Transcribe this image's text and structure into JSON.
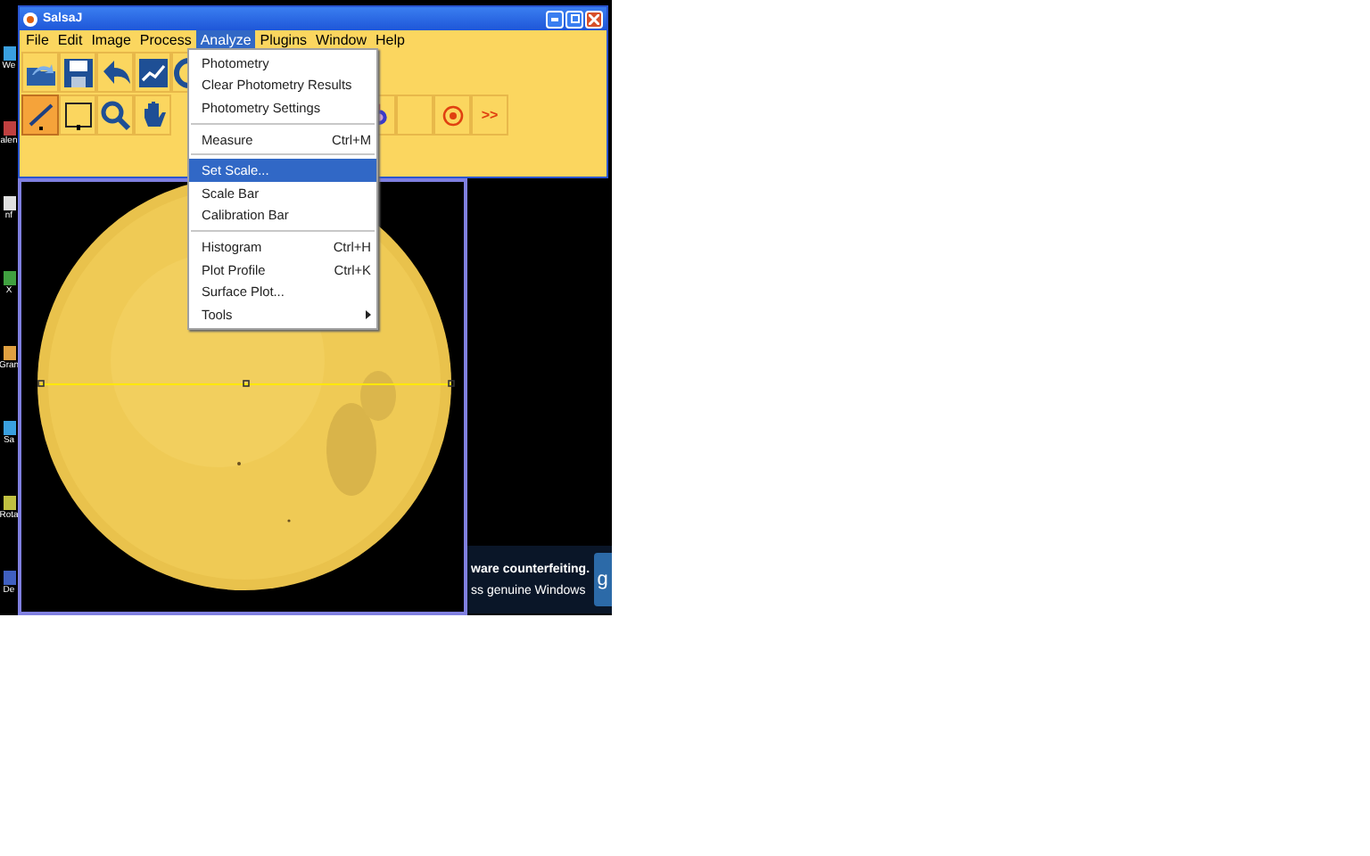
{
  "desktop": {
    "icon_labels": [
      "We",
      "alen",
      "nf",
      "X",
      "Gran",
      "Sa",
      "Rota",
      "De"
    ]
  },
  "app_window": {
    "title": "SalsaJ",
    "menu": [
      {
        "label": "File",
        "selected": false
      },
      {
        "label": "Edit",
        "selected": false
      },
      {
        "label": "Image",
        "selected": false
      },
      {
        "label": "Process",
        "selected": false
      },
      {
        "label": "Analyze",
        "selected": true
      },
      {
        "label": "Plugins",
        "selected": false
      },
      {
        "label": "Window",
        "selected": false
      },
      {
        "label": "Help",
        "selected": false
      }
    ],
    "toolbar_row_1": [
      {
        "kind": "open",
        "selected": false
      },
      {
        "kind": "save",
        "selected": false
      },
      {
        "kind": "undo",
        "selected": false
      },
      {
        "kind": "plot",
        "selected": false
      },
      {
        "kind": "ring",
        "selected": false
      }
    ],
    "toolbar_row_2_left": [
      {
        "kind": "line",
        "selected": true
      },
      {
        "kind": "rect",
        "selected": false
      },
      {
        "kind": "zoom",
        "selected": false
      },
      {
        "kind": "hand",
        "selected": false
      }
    ],
    "toolbar_row_2_right": [
      {
        "kind": "target",
        "selected": false
      },
      {
        "kind": "blank",
        "selected": false
      },
      {
        "kind": "stop",
        "selected": false
      },
      {
        "kind": "more",
        "label": ">>",
        "selected": false
      }
    ]
  },
  "analyze_menu": [
    {
      "kind": "item",
      "label": "Photometry",
      "selected": false
    },
    {
      "kind": "item",
      "label": "Clear Photometry Results",
      "selected": false
    },
    {
      "kind": "item",
      "label": "Photometry Settings",
      "selected": false
    },
    {
      "kind": "separator"
    },
    {
      "kind": "item",
      "label": "Measure",
      "shortcut": "Ctrl+M",
      "selected": false
    },
    {
      "kind": "separator"
    },
    {
      "kind": "item",
      "label": "Set Scale...",
      "selected": true
    },
    {
      "kind": "item",
      "label": "Scale Bar",
      "selected": false
    },
    {
      "kind": "item",
      "label": "Calibration Bar",
      "selected": false
    },
    {
      "kind": "separator"
    },
    {
      "kind": "item",
      "label": "Histogram",
      "shortcut": "Ctrl+H",
      "selected": false
    },
    {
      "kind": "item",
      "label": "Plot Profile",
      "shortcut": "Ctrl+K",
      "selected": false
    },
    {
      "kind": "item",
      "label": "Surface Plot...",
      "selected": false
    },
    {
      "kind": "submenu",
      "label": "Tools",
      "selected": false
    }
  ],
  "notification": {
    "lines": [
      "ware counterfeiting.",
      "ss genuine Windows"
    ],
    "button": "g"
  }
}
